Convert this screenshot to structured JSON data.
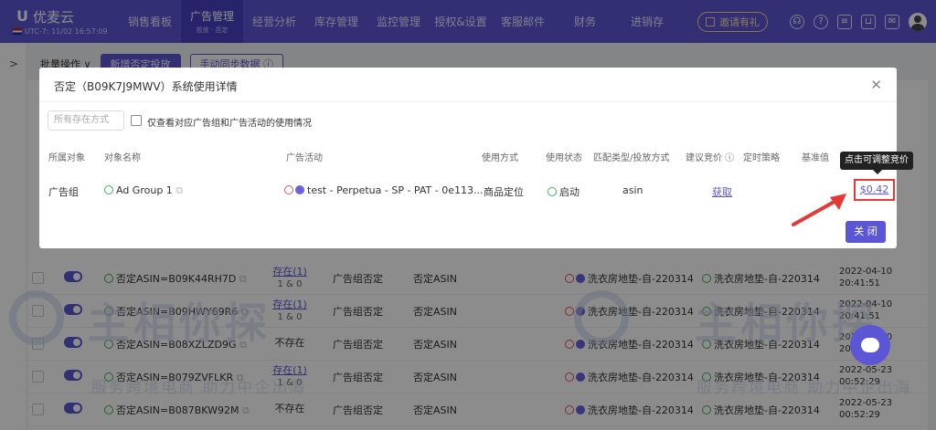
{
  "brand": {
    "name": "优麦云",
    "timezone": "UTC-7: 11/02 16:57:09"
  },
  "nav": {
    "items": [
      {
        "label": "销售看板",
        "sub": ""
      },
      {
        "label": "广告管理",
        "sub": "投放 · 否定"
      },
      {
        "label": "经营分析",
        "sub": ""
      },
      {
        "label": "库存管理",
        "sub": ""
      },
      {
        "label": "监控管理",
        "sub": ""
      },
      {
        "label": "授权&设置",
        "sub": ""
      },
      {
        "label": "客服邮件",
        "sub": ""
      },
      {
        "label": "财务",
        "sub": ""
      },
      {
        "label": "进销存",
        "sub": ""
      }
    ],
    "invite_label": "邀请有礼"
  },
  "toolbar": {
    "batch_label": "批量操作 ∨",
    "add_label": "新增否定投放",
    "sync_label": "手动同步数据 ⓘ"
  },
  "watermark": {
    "text": "主相你探",
    "sub": "服务跨境电商 助力中企出海"
  },
  "modal": {
    "title": "否定（B09K7J9MWV）系统使用详情",
    "filter_placeholder": "所有存在方式",
    "filter_checkbox_label": "仅查看对应广告组和广告活动的使用情况",
    "columns": [
      "所属对象",
      "对象名称",
      "广告活动",
      "使用方式",
      "使用状态",
      "匹配类型/投放方式",
      "建议竞价 ⓘ",
      "定时策略",
      "基准值"
    ],
    "row": {
      "object_type": "广告组",
      "object_name": "Ad Group 1",
      "campaign": "test - Perpetua - SP - PAT - 0e113...",
      "usage_method": "商品定位",
      "usage_status": "启动",
      "match_type": "asin",
      "suggested_bid": "获取",
      "bid": "$0.42"
    },
    "tooltip": "点击可调整竞价",
    "close_label": "关 闭"
  },
  "table": {
    "rows": [
      {
        "target": "否定ASIN=B09K44RH7D",
        "exist": "存在(1)",
        "exist_sub": "1 & 0",
        "level": "广告组否定",
        "neg_type": "否定ASIN",
        "campaign": "洗衣房地垫-自-220314",
        "group": "洗衣房地垫-自-220314",
        "date": "2022-04-10",
        "time": "20:41:51"
      },
      {
        "target": "否定ASIN=B09HWY69R6",
        "exist": "存在(1)",
        "exist_sub": "1 & 0",
        "level": "广告组否定",
        "neg_type": "否定ASIN",
        "campaign": "洗衣房地垫-自-220314",
        "group": "洗衣房地垫-自-220314",
        "date": "2022-04-10",
        "time": "20:41:51"
      },
      {
        "target": "否定ASIN=B08XZLZD9G",
        "exist": "不存在",
        "exist_sub": "",
        "level": "广告组否定",
        "neg_type": "否定ASIN",
        "campaign": "洗衣房地垫-自-220314",
        "group": "洗衣房地垫-自-220314",
        "date": "2022-04-10",
        "time": "20:41:51"
      },
      {
        "target": "否定ASIN=B079ZVFLKR",
        "exist": "存在(1)",
        "exist_sub": "1 & 0",
        "level": "广告组否定",
        "neg_type": "否定ASIN",
        "campaign": "洗衣房地垫-自-220314",
        "group": "洗衣房地垫-自-220314",
        "date": "2022-05-23",
        "time": "00:52:29"
      },
      {
        "target": "否定ASIN=B087BKW92M",
        "exist": "不存在",
        "exist_sub": "",
        "level": "广告组否定",
        "neg_type": "否定ASIN",
        "campaign": "洗衣房地垫-自-220314",
        "group": "洗衣房地垫-自-220314",
        "date": "2022-05-23",
        "time": "00:52:29"
      }
    ]
  },
  "colors": {
    "accent": "#5b56d6",
    "highlight": "#e53935",
    "success": "#3ab35c",
    "paused": "#e05555"
  }
}
